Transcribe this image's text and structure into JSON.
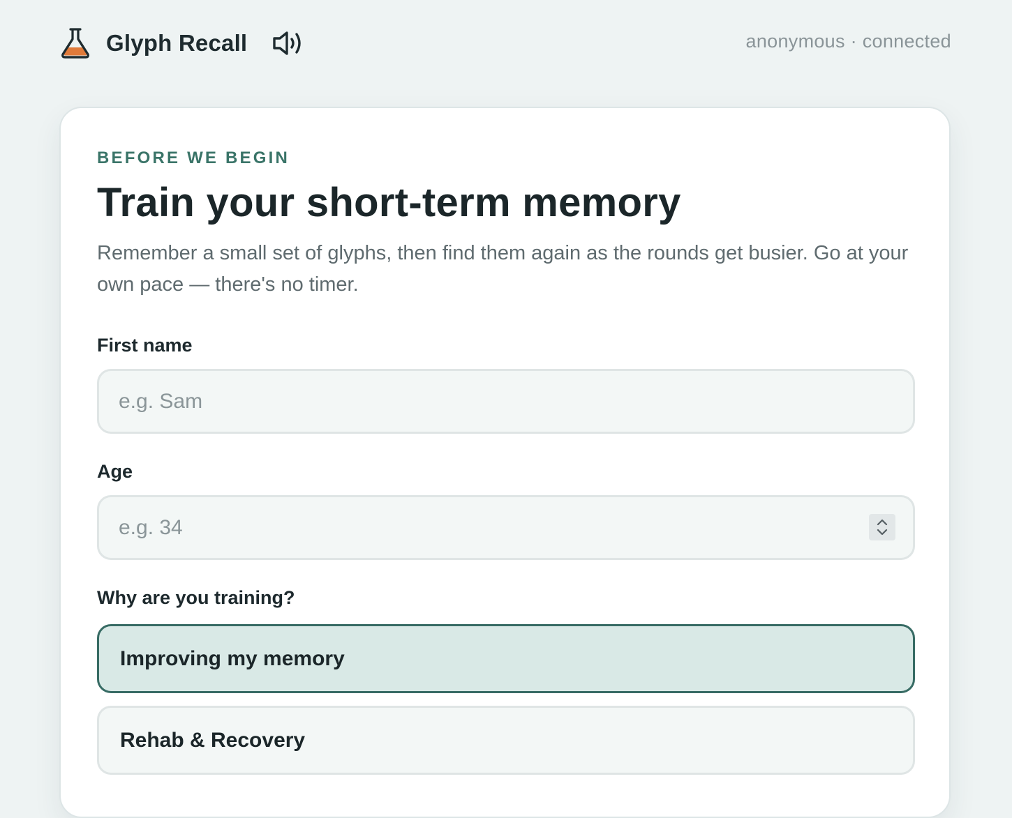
{
  "header": {
    "brand_title": "Glyph Recall",
    "brand_icon": "flask-icon",
    "sound_icon": "speaker-icon",
    "status": "anonymous · connected"
  },
  "colors": {
    "accent": "#3a7468",
    "flask_fill": "#e07a3a",
    "selected_bg": "#d9e9e6",
    "selected_border": "#376b64"
  },
  "card": {
    "eyebrow": "BEFORE WE BEGIN",
    "title": "Train your short-term memory",
    "subtitle": "Remember a small set of glyphs, then find them again as the rounds get busier. Go at your own pace — there's no timer."
  },
  "form": {
    "first_name": {
      "label": "First name",
      "placeholder": "e.g. Sam",
      "value": ""
    },
    "age": {
      "label": "Age",
      "placeholder": "e.g. 34",
      "value": ""
    },
    "reason": {
      "label": "Why are you training?",
      "options": [
        {
          "label": "Improving my memory",
          "selected": true
        },
        {
          "label": "Rehab & Recovery",
          "selected": false
        }
      ]
    }
  }
}
